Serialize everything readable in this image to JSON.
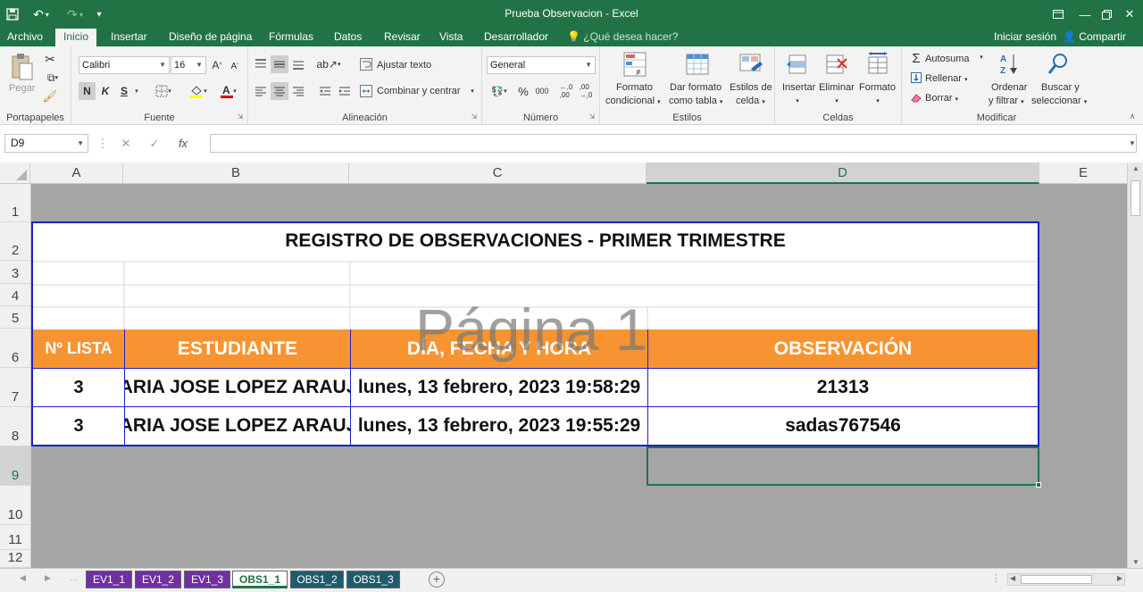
{
  "window": {
    "title": "Prueba Observacion - Excel",
    "qa_save_icon": "save-icon",
    "qa_undo_icon": "undo-icon",
    "qa_redo_icon": "redo-icon",
    "window_controls": [
      "ribbon-options-icon",
      "minimize-icon",
      "restore-icon",
      "close-icon"
    ]
  },
  "tabs": [
    {
      "label": "Archivo"
    },
    {
      "label": "Inicio"
    },
    {
      "label": "Insertar"
    },
    {
      "label": "Diseño de página"
    },
    {
      "label": "Fórmulas"
    },
    {
      "label": "Datos"
    },
    {
      "label": "Revisar"
    },
    {
      "label": "Vista"
    },
    {
      "label": "Desarrollador"
    }
  ],
  "help": "¿Qué desea hacer?",
  "signin": "Iniciar sesión",
  "share": "Compartir",
  "ribbon": {
    "clipboard": {
      "paste": "Pegar",
      "label": "Portapapeles"
    },
    "font": {
      "name": "Calibri",
      "size": "16",
      "bold": "N",
      "italic": "K",
      "underline": "S",
      "label": "Fuente"
    },
    "alignment": {
      "wrap": "Ajustar texto",
      "merge": "Combinar y centrar",
      "label": "Alineación"
    },
    "number": {
      "format": "General",
      "percent": "%",
      "thousands": "000",
      "label": "Número"
    },
    "styles": {
      "conditional_1": "Formato",
      "conditional_2": "condicional",
      "as_table_1": "Dar formato",
      "as_table_2": "como tabla",
      "cell_styles_1": "Estilos de",
      "cell_styles_2": "celda",
      "label": "Estilos"
    },
    "cells": {
      "insert": "Insertar",
      "delete": "Eliminar",
      "format": "Formato",
      "label": "Celdas"
    },
    "editing": {
      "autosum": "Autosuma",
      "fill": "Rellenar",
      "clear": "Borrar",
      "sort_1": "Ordenar",
      "sort_2": "y filtrar",
      "find_1": "Buscar y",
      "find_2": "seleccionar",
      "label": "Modificar"
    }
  },
  "formula_bar": {
    "name_box": "D9",
    "value": ""
  },
  "columns": [
    "A",
    "B",
    "C",
    "D",
    "E"
  ],
  "rows": [
    "1",
    "2",
    "3",
    "4",
    "5",
    "6",
    "7",
    "8",
    "9",
    "10",
    "11",
    "12"
  ],
  "sheet": {
    "title": "REGISTRO DE OBSERVACIONES - PRIMER TRIMESTRE",
    "watermark": "Página 1",
    "header": [
      "Nº LISTA",
      "ESTUDIANTE",
      "DÍA, FECHA Y HORA",
      "OBSERVACIÓN"
    ],
    "data_rows": [
      [
        "3",
        "MARIA JOSE LOPEZ ARAUJO",
        "lunes, 13 febrero, 2023  19:58:29",
        "21313"
      ],
      [
        "3",
        "MARIA JOSE LOPEZ ARAUJO",
        "lunes, 13 febrero, 2023  19:55:29",
        "sadas767546"
      ]
    ],
    "header_color": "#f79431",
    "border_color": "#1f20c8"
  },
  "sheet_tabs": [
    {
      "label": "EV1_1",
      "color": "#7030a0"
    },
    {
      "label": "EV1_2",
      "color": "#7030a0"
    },
    {
      "label": "EV1_3",
      "color": "#7030a0"
    },
    {
      "label": "OBS1_1",
      "color": "#ffffff"
    },
    {
      "label": "OBS1_2",
      "color": "#1f5c6b"
    },
    {
      "label": "OBS1_3",
      "color": "#1f5c6b"
    }
  ]
}
